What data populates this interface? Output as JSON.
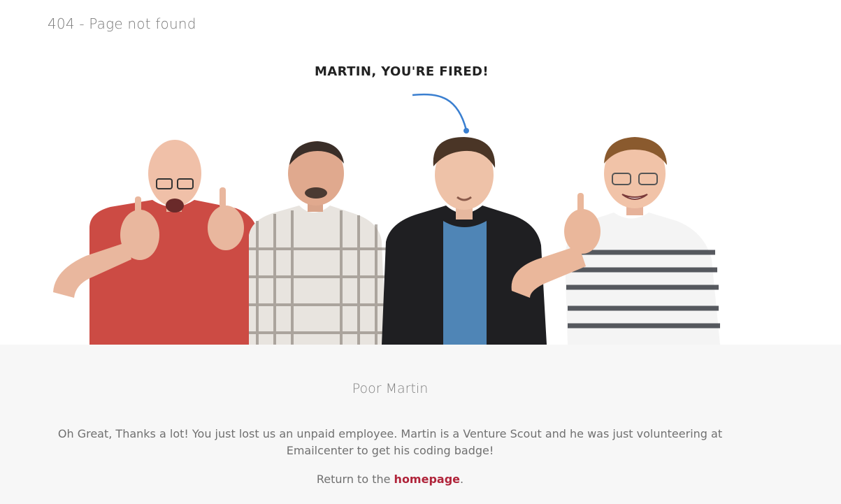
{
  "page": {
    "title": "404 - Page not found"
  },
  "speech_bubble": {
    "text": "MARTIN, YOU'RE FIRED!"
  },
  "colors": {
    "pointer": "#3a7fd0",
    "link": "#b0243a",
    "band": "#f7f7f7"
  },
  "content": {
    "subtitle": "Poor Martin",
    "message": "Oh Great, Thanks a lot! You just lost us an unpaid employee. Martin is a Venture Scout and he was just volunteering at Emailcenter to get his coding badge!",
    "return_prefix": "Return to the ",
    "return_link": "homepage",
    "return_suffix": "."
  }
}
